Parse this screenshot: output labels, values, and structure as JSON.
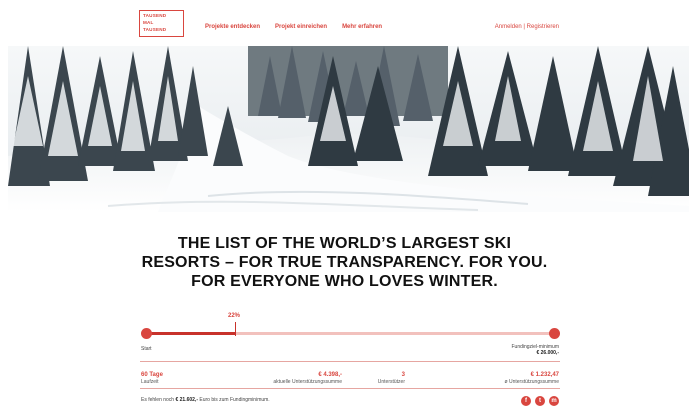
{
  "header": {
    "logo_lines": [
      "TAUSEND",
      "MAL",
      "TAUSEND"
    ],
    "nav": [
      "Projekte entdecken",
      "Projekt einreichen",
      "Mehr erfahren"
    ],
    "auth": "Anmelden | Registrieren"
  },
  "hero": {
    "alt": "snowy forest ski slope"
  },
  "title": {
    "lines": [
      "THE LIST OF THE WORLD’S LARGEST SKI",
      "RESORTS – FOR TRUE TRANSPARENCY. FOR YOU.",
      "FOR EVERYONE WHO LOVES WINTER."
    ]
  },
  "progress": {
    "percent_label": "22%",
    "percent": 22,
    "start_label": "Start",
    "goal_label": "Fundingziel-minimum",
    "goal_value": "€ 26.000,-"
  },
  "stats": [
    {
      "value": "60 Tage",
      "label": "Laufzeit"
    },
    {
      "value": "€ 4.398,-",
      "label": "aktuelle Unterstützungssumme"
    },
    {
      "value": "3",
      "label": "Unterstützer"
    },
    {
      "value": "€ 1.232,47",
      "label": "ø Unterstützungssumme"
    }
  ],
  "footer": {
    "text_prefix": "Es fehlen noch ",
    "missing_amount": "€ 21.602,-",
    "text_suffix": " Euro bis zum Fundingminimum."
  },
  "social": [
    "f",
    "t",
    "m"
  ],
  "colors": {
    "accent": "#d9463f",
    "accent_dark": "#c8322b",
    "track": "#f2c1bd"
  }
}
